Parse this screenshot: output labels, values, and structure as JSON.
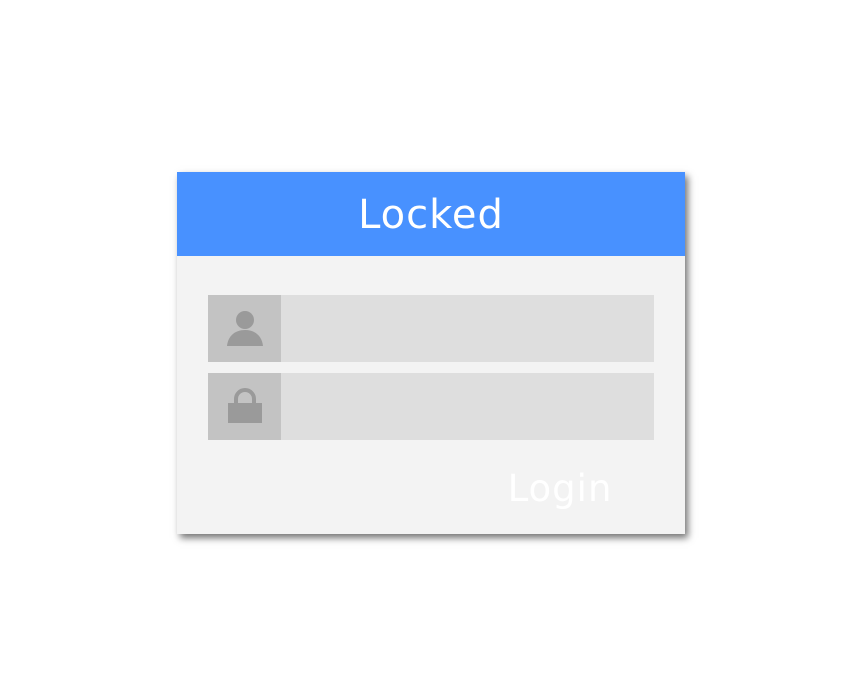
{
  "card": {
    "title": "Locked"
  },
  "fields": {
    "username": {
      "icon": "user-icon",
      "value": "",
      "placeholder": ""
    },
    "password": {
      "icon": "lock-icon",
      "value": "",
      "placeholder": ""
    }
  },
  "actions": {
    "login_label": "Login"
  },
  "colors": {
    "header": "#4891ff",
    "card_background": "#f3f3f3",
    "field_background": "#dedede",
    "icon_box": "#c3c3c3",
    "icon": "#9a9a9a",
    "button_text": "#ffffff"
  }
}
